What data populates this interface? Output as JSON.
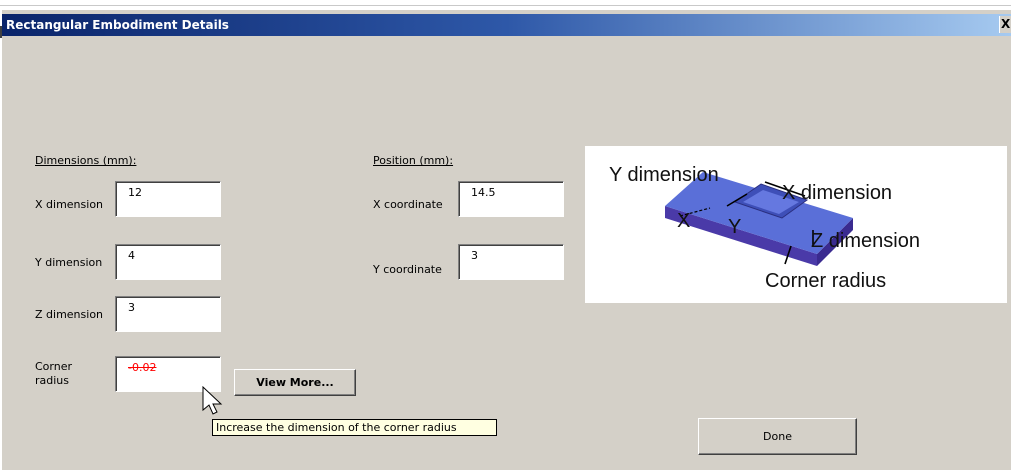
{
  "window": {
    "title": "Rectangular  Embodiment Details",
    "close_glyph": "X"
  },
  "dimensions": {
    "section_label": "Dimensions (mm):",
    "x_label": "X dimension",
    "x_value": "12",
    "y_label": "Y dimension",
    "y_value": "4",
    "z_label": "Z dimension",
    "z_value": "3",
    "corner_label_line1": "Corner",
    "corner_label_line2": "radius",
    "corner_value": "-0.02"
  },
  "position": {
    "section_label": "Position (mm):",
    "x_label": "X coordinate",
    "x_value": "14.5",
    "y_label": "Y coordinate",
    "y_value": "3"
  },
  "buttons": {
    "view_more": "View More...",
    "done": "Done"
  },
  "tooltip": {
    "text": "Increase the dimension of the corner radius"
  },
  "diagram": {
    "y_dimension": "Y dimension",
    "x_dimension": "X dimension",
    "z_dimension": "Z dimension",
    "corner_radius": "Corner radius",
    "x_small": "X",
    "y_small": "Y",
    "block_color": "#5a6fd8"
  }
}
